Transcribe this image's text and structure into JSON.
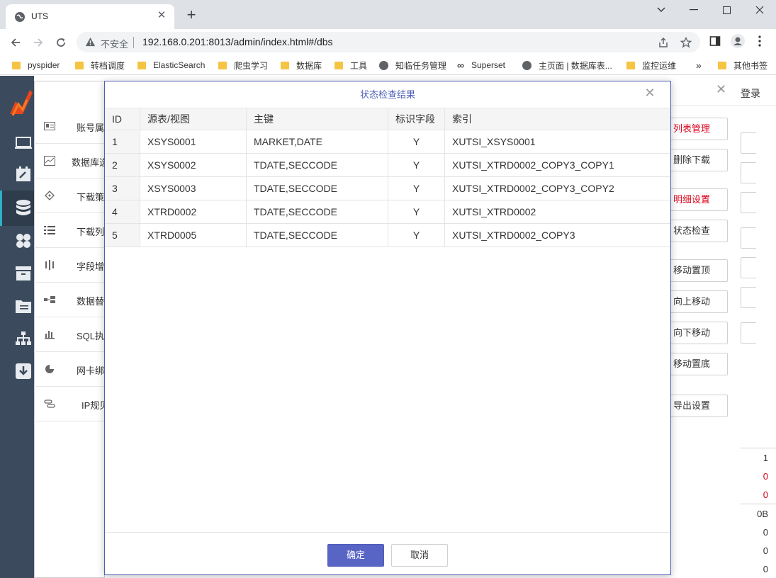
{
  "browser": {
    "tab_title": "UTS",
    "not_secure_label": "不安全",
    "url": "192.168.0.201:8013/admin/index.html#/dbs",
    "bookmarks": [
      {
        "label": "pyspider",
        "icon": "folder-icon"
      },
      {
        "label": "转档调度",
        "icon": "folder-icon"
      },
      {
        "label": "ElasticSearch",
        "icon": "folder-icon"
      },
      {
        "label": "爬虫学习",
        "icon": "folder-icon"
      },
      {
        "label": "数据库",
        "icon": "folder-icon"
      },
      {
        "label": "工具",
        "icon": "folder-icon"
      },
      {
        "label": "知临任务管理",
        "icon": "globe-icon"
      },
      {
        "label": "Superset",
        "icon": "infinity-icon"
      },
      {
        "label": "主页面 | 数据库表...",
        "icon": "globe-icon"
      },
      {
        "label": "监控运维",
        "icon": "folder-icon"
      }
    ],
    "more_bookmarks": "»",
    "other_bookmarks": "其他书签"
  },
  "app": {
    "menu_items": [
      {
        "label": "账号属",
        "icon": "id-card-icon"
      },
      {
        "label": "数据库选",
        "icon": "line-chart-icon"
      },
      {
        "label": "下载策",
        "icon": "diamond-icon"
      },
      {
        "label": "下载列",
        "icon": "list-icon"
      },
      {
        "label": "字段增",
        "icon": "columns-icon"
      },
      {
        "label": "数据替",
        "icon": "swap-icon"
      },
      {
        "label": "SQL执",
        "icon": "bar-chart-icon"
      },
      {
        "label": "网卡绑",
        "icon": "pie-chart-icon"
      },
      {
        "label": "IP规贝",
        "icon": "link-icon"
      }
    ],
    "login_label": "登录",
    "right_buttons": [
      {
        "label": "列表管理",
        "red": true
      },
      {
        "label": "删除下载",
        "red": false
      },
      {
        "label": "明细设置",
        "red": true
      },
      {
        "label": "状态检查",
        "red": false
      },
      {
        "label": "移动置顶",
        "red": false
      },
      {
        "label": "向上移动",
        "red": false
      },
      {
        "label": "向下移动",
        "red": false
      },
      {
        "label": "移动置底",
        "red": false
      },
      {
        "label": "导出设置",
        "red": false
      }
    ],
    "right_values": [
      {
        "value": "1",
        "red": false
      },
      {
        "value": "0",
        "red": true
      },
      {
        "value": "0",
        "red": true
      },
      {
        "value": "0B",
        "red": false
      },
      {
        "value": "0",
        "red": false
      },
      {
        "value": "0",
        "red": false
      },
      {
        "value": "0",
        "red": false
      }
    ]
  },
  "dialog": {
    "title": "状态检查结果",
    "columns": [
      "ID",
      "源表/视图",
      "主键",
      "标识字段",
      "索引"
    ],
    "rows": [
      {
        "id": "1",
        "source": "XSYS0001",
        "key": "MARKET,DATE",
        "flag": "Y",
        "index": "XUTSI_XSYS0001"
      },
      {
        "id": "2",
        "source": "XSYS0002",
        "key": "TDATE,SECCODE",
        "flag": "Y",
        "index": "XUTSI_XTRD0002_COPY3_COPY1"
      },
      {
        "id": "3",
        "source": "XSYS0003",
        "key": "TDATE,SECCODE",
        "flag": "Y",
        "index": "XUTSI_XTRD0002_COPY3_COPY2"
      },
      {
        "id": "4",
        "source": "XTRD0002",
        "key": "TDATE,SECCODE",
        "flag": "Y",
        "index": "XUTSI_XTRD0002"
      },
      {
        "id": "5",
        "source": "XTRD0005",
        "key": "TDATE,SECCODE",
        "flag": "Y",
        "index": "XUTSI_XTRD0002_COPY3"
      }
    ],
    "ok_label": "确定",
    "cancel_label": "取消"
  }
}
